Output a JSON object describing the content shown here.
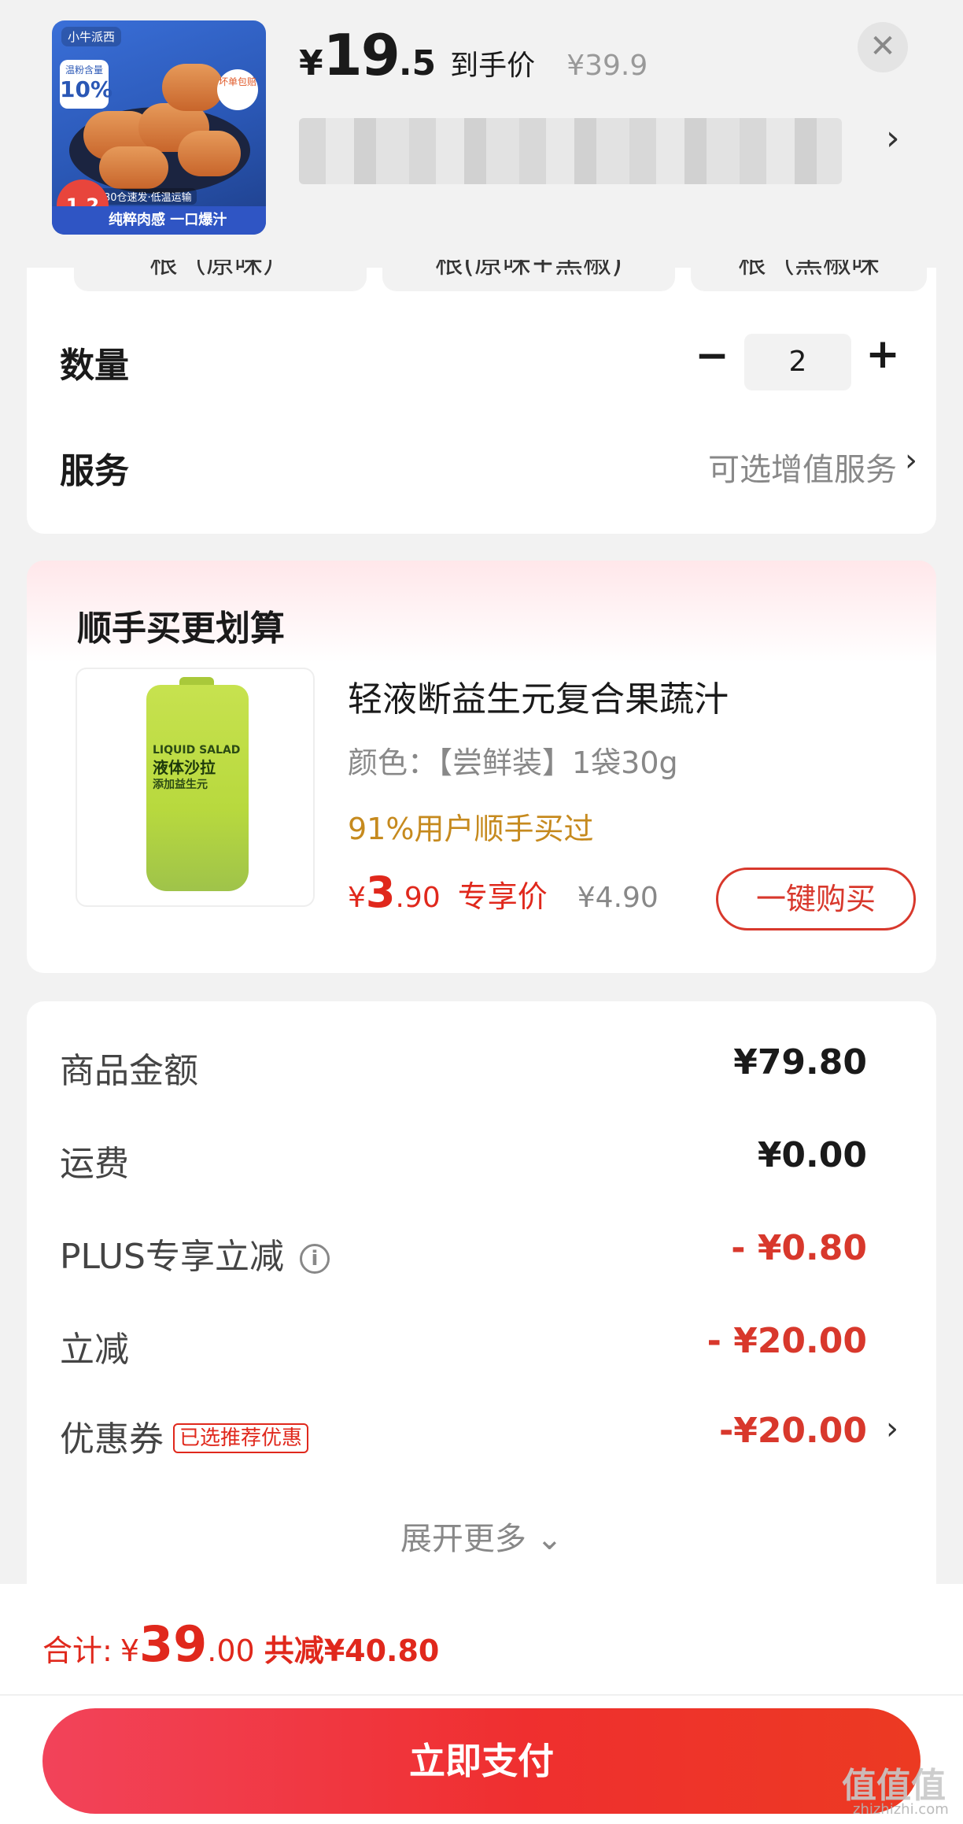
{
  "header": {
    "product_thumb": {
      "brand_text": "小牛派西",
      "tag_small": "温粉含量",
      "tag_percent": "10%",
      "bubble_text": "坏单包赔",
      "shipping_text": "30仓速发·低温运输",
      "bottom_text": "纯粹肉感 一口爆汁",
      "price_bubble": "1.2"
    },
    "price_symbol": "¥",
    "price_integer": "19",
    "price_decimal": ".5",
    "price_label": "到手价",
    "original_price": "¥39.9",
    "close_icon": "close-icon",
    "sku_chevron_icon": "chevron-right-icon"
  },
  "spec": {
    "options": [
      {
        "label": "根（原味）"
      },
      {
        "label": "根(原味+黑椒)"
      },
      {
        "label": "根（黑椒味"
      }
    ],
    "quantity_label": "数量",
    "quantity_value": "2",
    "minus_label": "−",
    "plus_label": "+",
    "service_label": "服务",
    "service_value": "可选增值服务"
  },
  "upsell": {
    "title": "顺手买更划算",
    "product_image": {
      "line1": "LIQUID SALAD",
      "line2": "液体沙拉",
      "line3": "添加益生元"
    },
    "name": "轻液断益生元复合果蔬汁",
    "spec": "颜色：【尝鲜装】1袋30g",
    "social_proof": "91%用户顺手买过",
    "price_symbol": "¥",
    "price_integer": "3",
    "price_decimal": ".90",
    "price_label": "专享价",
    "original_price": "¥4.90",
    "buy_button": "一键购买"
  },
  "summary": {
    "rows": [
      {
        "label": "商品金额",
        "value": "¥79.80"
      },
      {
        "label": "运费",
        "value": "¥0.00"
      },
      {
        "label": "PLUS专享立减",
        "value": "- ¥0.80"
      },
      {
        "label": "立减",
        "value": "- ¥20.00"
      },
      {
        "label": "优惠券",
        "value": "-¥20.00",
        "badge": "已选推荐优惠"
      }
    ],
    "info_icon": "i",
    "expand_more": "展开更多 ⌄"
  },
  "footer": {
    "total_label": "合计:",
    "total_symbol": "¥",
    "total_integer": "39",
    "total_decimal": ".00",
    "total_saved": "共减¥40.80",
    "pay_button": "立即支付"
  },
  "watermark": {
    "text": "值值值",
    "sub": "zhizhizhi.com"
  },
  "colors": {
    "accent_red": "#e0281c",
    "gold_text": "#c68a1e",
    "page_bg": "#f2f2f2"
  }
}
